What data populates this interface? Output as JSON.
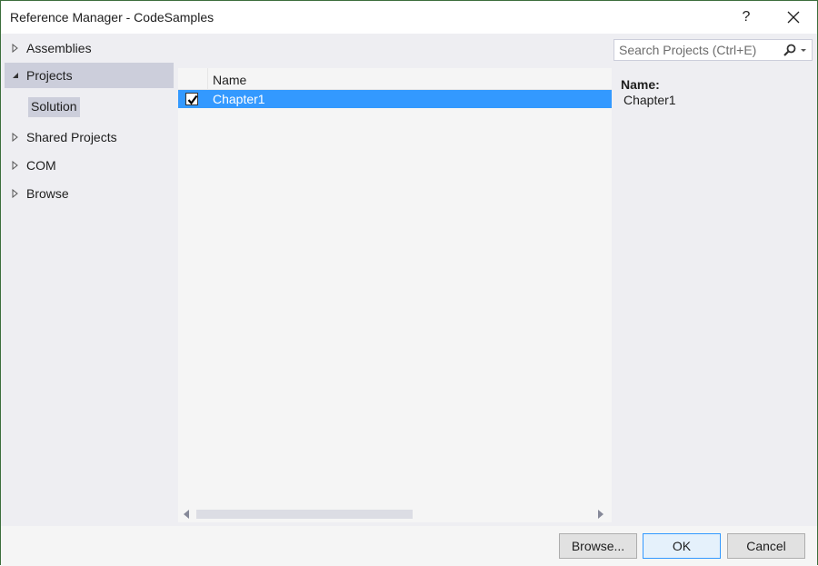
{
  "window": {
    "title": "Reference Manager - CodeSamples",
    "help_label": "?",
    "close_icon": "close-icon"
  },
  "sidebar": {
    "items": [
      {
        "label": "Assemblies",
        "expanded": false,
        "icon": "expand-right-icon"
      },
      {
        "label": "Projects",
        "expanded": true,
        "selected": true,
        "icon": "expanded-down-icon"
      },
      {
        "label": "Shared Projects",
        "expanded": false,
        "icon": "expand-right-icon"
      },
      {
        "label": "COM",
        "expanded": false,
        "icon": "expand-right-icon"
      },
      {
        "label": "Browse",
        "expanded": false,
        "icon": "expand-right-icon"
      }
    ],
    "sub_items": [
      {
        "label": "Solution",
        "selected": true
      }
    ]
  },
  "list": {
    "columns": [
      "Name"
    ],
    "rows": [
      {
        "checked": true,
        "name": "Chapter1",
        "selected": true
      }
    ],
    "scroll": {
      "horizontal_thumb_fraction": 0.5
    }
  },
  "search": {
    "placeholder": "Search Projects (Ctrl+E)",
    "value": ""
  },
  "details": {
    "label": "Name:",
    "value": "Chapter1"
  },
  "footer": {
    "browse_label": "Browse...",
    "ok_label": "OK",
    "cancel_label": "Cancel"
  },
  "colors": {
    "selection": "#3399ff",
    "sidebar_selected": "#cccedb",
    "background": "#eeeef2"
  }
}
